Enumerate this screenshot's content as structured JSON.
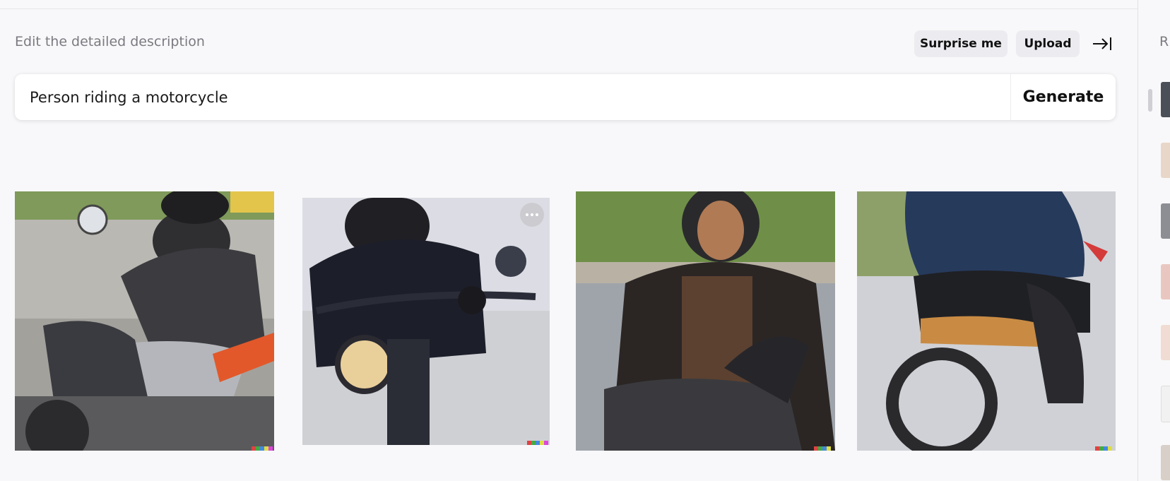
{
  "editor": {
    "title": "Edit the detailed description",
    "surprise_label": "Surprise me",
    "upload_label": "Upload",
    "prompt_value": "Person riding a motorcycle",
    "generate_label": "Generate"
  },
  "results": {
    "images": [
      {
        "alt": "Rider in leather jacket on black motorcycle"
      },
      {
        "alt": "Rider with black helmet leaning on handlebars"
      },
      {
        "alt": "Young man in helmet riding toward camera"
      },
      {
        "alt": "Rider in blue leather on vintage motorcycle"
      }
    ]
  },
  "sidebar": {
    "title": "R",
    "thumbnails": [
      "history-1",
      "history-2",
      "history-3",
      "history-4",
      "history-5",
      "history-6",
      "history-7"
    ]
  },
  "colors": {
    "background": "#f8f8fa",
    "button_bg": "#ececf0",
    "text_primary": "#111111",
    "text_muted": "#7a7a80"
  },
  "icons": {
    "collapse": "arrow-right-bar-icon",
    "more": "ellipsis-icon"
  }
}
